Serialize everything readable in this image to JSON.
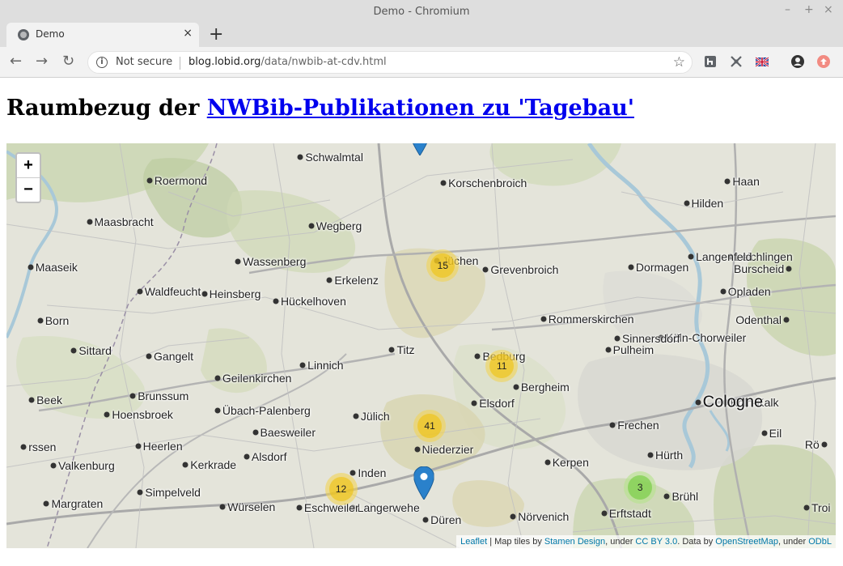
{
  "window": {
    "title": "Demo - Chromium",
    "controls": [
      "–",
      "+",
      "×"
    ]
  },
  "tab": {
    "label": "Demo",
    "close": "×",
    "new_tab": "+"
  },
  "toolbar": {
    "back": "←",
    "forward": "→",
    "reload": "↻",
    "security_label": "Not secure",
    "url_host": "blog.lobid.org",
    "url_path": "/data/nwbib-at-cdv.html",
    "star": "☆"
  },
  "page": {
    "title_prefix": "Raumbezug der ",
    "title_link": "NWBib-Publikationen zu 'Tagebau'"
  },
  "map": {
    "zoom_in": "+",
    "zoom_out": "−",
    "colors": {
      "cluster_medium": "#f0c20c",
      "cluster_small": "#6ecc39",
      "marker": "#2a81cb",
      "water": "#a8c8d8"
    },
    "places": [
      {
        "name": "Roermond",
        "lon": 6.0,
        "lat": 51.194
      },
      {
        "name": "Schwalmtal",
        "lon": 6.264,
        "lat": 51.221
      },
      {
        "name": "Korschenbroich",
        "lon": 6.514,
        "lat": 51.191
      },
      {
        "name": "Haan",
        "lon": 7.011,
        "lat": 51.193
      },
      {
        "name": "Maasbracht",
        "lon": 5.895,
        "lat": 51.146
      },
      {
        "name": "Wegberg",
        "lon": 6.283,
        "lat": 51.142
      },
      {
        "name": "Hilden",
        "lon": 6.939,
        "lat": 51.168
      },
      {
        "name": "Leichlingen",
        "lon": 7.016,
        "lat": 51.106
      },
      {
        "name": "Maaseik",
        "lon": 5.792,
        "lat": 51.094
      },
      {
        "name": "Wassenberg",
        "lon": 6.155,
        "lat": 51.101
      },
      {
        "name": "Jüchen",
        "lon": 6.503,
        "lat": 51.102
      },
      {
        "name": "Grevenbroich",
        "lon": 6.588,
        "lat": 51.091
      },
      {
        "name": "Dormagen",
        "lon": 6.842,
        "lat": 51.094
      },
      {
        "name": "Burscheid",
        "lon": 7.118,
        "lat": 51.092
      },
      {
        "name": "Langenfeld",
        "lon": 6.947,
        "lat": 51.106
      },
      {
        "name": "Heinsberg",
        "lon": 6.096,
        "lat": 51.063
      },
      {
        "name": "Erkelenz",
        "lon": 6.315,
        "lat": 51.079
      },
      {
        "name": "Waldfeucht",
        "lon": 5.983,
        "lat": 51.066
      },
      {
        "name": "Köln-Chorweiler",
        "lon": 6.894,
        "lat": 51.013
      },
      {
        "name": "Opladen",
        "lon": 7.003,
        "lat": 51.066
      },
      {
        "name": "Hückelhoven",
        "lon": 6.221,
        "lat": 51.055
      },
      {
        "name": "Born",
        "lon": 5.809,
        "lat": 51.032
      },
      {
        "name": "Odenthal",
        "lon": 7.114,
        "lat": 51.033
      },
      {
        "name": "Sittard",
        "lon": 5.868,
        "lat": 50.998
      },
      {
        "name": "Titz",
        "lon": 6.424,
        "lat": 50.999
      },
      {
        "name": "Rommerskirchen",
        "lon": 6.689,
        "lat": 51.034
      },
      {
        "name": "Sinnersdorf",
        "lon": 6.818,
        "lat": 51.012
      },
      {
        "name": "Gangelt",
        "lon": 5.999,
        "lat": 50.991
      },
      {
        "name": "Pulheim",
        "lon": 6.802,
        "lat": 50.999
      },
      {
        "name": "Linnich",
        "lon": 6.268,
        "lat": 50.981
      },
      {
        "name": "Bedburg",
        "lon": 6.574,
        "lat": 50.991
      },
      {
        "name": "Geilenkirchen",
        "lon": 6.119,
        "lat": 50.966
      },
      {
        "name": "Bergheim",
        "lon": 6.641,
        "lat": 50.956
      },
      {
        "name": "Köln-Kalk",
        "lon": 7.007,
        "lat": 50.938
      },
      {
        "name": "Brunssum",
        "lon": 5.971,
        "lat": 50.946
      },
      {
        "name": "Beek",
        "lon": 5.794,
        "lat": 50.941
      },
      {
        "name": "Übach-Palenberg",
        "lon": 6.119,
        "lat": 50.929
      },
      {
        "name": "Jülich",
        "lon": 6.361,
        "lat": 50.922
      },
      {
        "name": "Elsdorf",
        "lon": 6.568,
        "lat": 50.937
      },
      {
        "name": "Hoensbroek",
        "lon": 5.926,
        "lat": 50.924
      },
      {
        "name": "Baesweiler",
        "lon": 6.185,
        "lat": 50.904
      },
      {
        "name": "Cologne",
        "lon": 6.959,
        "lat": 50.938
      },
      {
        "name": "Frechen",
        "lon": 6.81,
        "lat": 50.912
      },
      {
        "name": "Eil",
        "lon": 7.075,
        "lat": 50.903
      },
      {
        "name": "Heerlen",
        "lon": 5.98,
        "lat": 50.888
      },
      {
        "name": "Alsdorf",
        "lon": 6.17,
        "lat": 50.876
      },
      {
        "name": "Niederzier",
        "lon": 6.468,
        "lat": 50.884
      },
      {
        "name": "Inden",
        "lon": 6.356,
        "lat": 50.857
      },
      {
        "name": "Hürth",
        "lon": 6.876,
        "lat": 50.877
      },
      {
        "name": "Valkenburg",
        "lon": 5.832,
        "lat": 50.865
      },
      {
        "name": "Kerkrade",
        "lon": 6.063,
        "lat": 50.866
      },
      {
        "name": "Kerpen",
        "lon": 6.696,
        "lat": 50.869
      },
      {
        "name": "Simpelveld",
        "lon": 5.984,
        "lat": 50.834
      },
      {
        "name": "Brühl",
        "lon": 6.905,
        "lat": 50.83
      },
      {
        "name": "Margraten",
        "lon": 5.82,
        "lat": 50.821
      },
      {
        "name": "Würselen",
        "lon": 6.128,
        "lat": 50.818
      },
      {
        "name": "Langerwehe",
        "lon": 6.355,
        "lat": 50.817
      },
      {
        "name": "Erftstadt",
        "lon": 6.795,
        "lat": 50.81
      },
      {
        "name": "Troi",
        "lon": 7.149,
        "lat": 50.817
      },
      {
        "name": "Eschweiler",
        "lon": 6.262,
        "lat": 50.817
      },
      {
        "name": "Düren",
        "lon": 6.483,
        "lat": 50.803
      },
      {
        "name": "Nörvenich",
        "lon": 6.636,
        "lat": 50.806
      },
      {
        "name": "rssen",
        "lon": 5.78,
        "lat": 50.887
      },
      {
        "name": "Rö",
        "lon": 7.18,
        "lat": 50.89
      }
    ],
    "clusters": [
      {
        "count": "15",
        "lon": 6.513,
        "lat": 51.096,
        "size": "medium"
      },
      {
        "count": "11",
        "lon": 6.616,
        "lat": 50.98,
        "size": "medium"
      },
      {
        "count": "41",
        "lon": 6.49,
        "lat": 50.911,
        "size": "medium"
      },
      {
        "count": "12",
        "lon": 6.335,
        "lat": 50.838,
        "size": "medium"
      },
      {
        "count": "3",
        "lon": 6.858,
        "lat": 50.84,
        "size": "small"
      }
    ],
    "markers": [
      {
        "name": "marker-north",
        "lon": 6.473,
        "lat": 51.223
      },
      {
        "name": "marker-dueren",
        "lon": 6.48,
        "lat": 50.826
      }
    ]
  },
  "attribution": {
    "leaflet": "Leaflet",
    "tiles_text": " | Map tiles by ",
    "stamen": "Stamen Design",
    "under1": ", under ",
    "ccby": "CC BY 3.0",
    "data_by": ". Data by ",
    "osm": "OpenStreetMap",
    "under2": ", under ",
    "odbl": "ODbL"
  }
}
